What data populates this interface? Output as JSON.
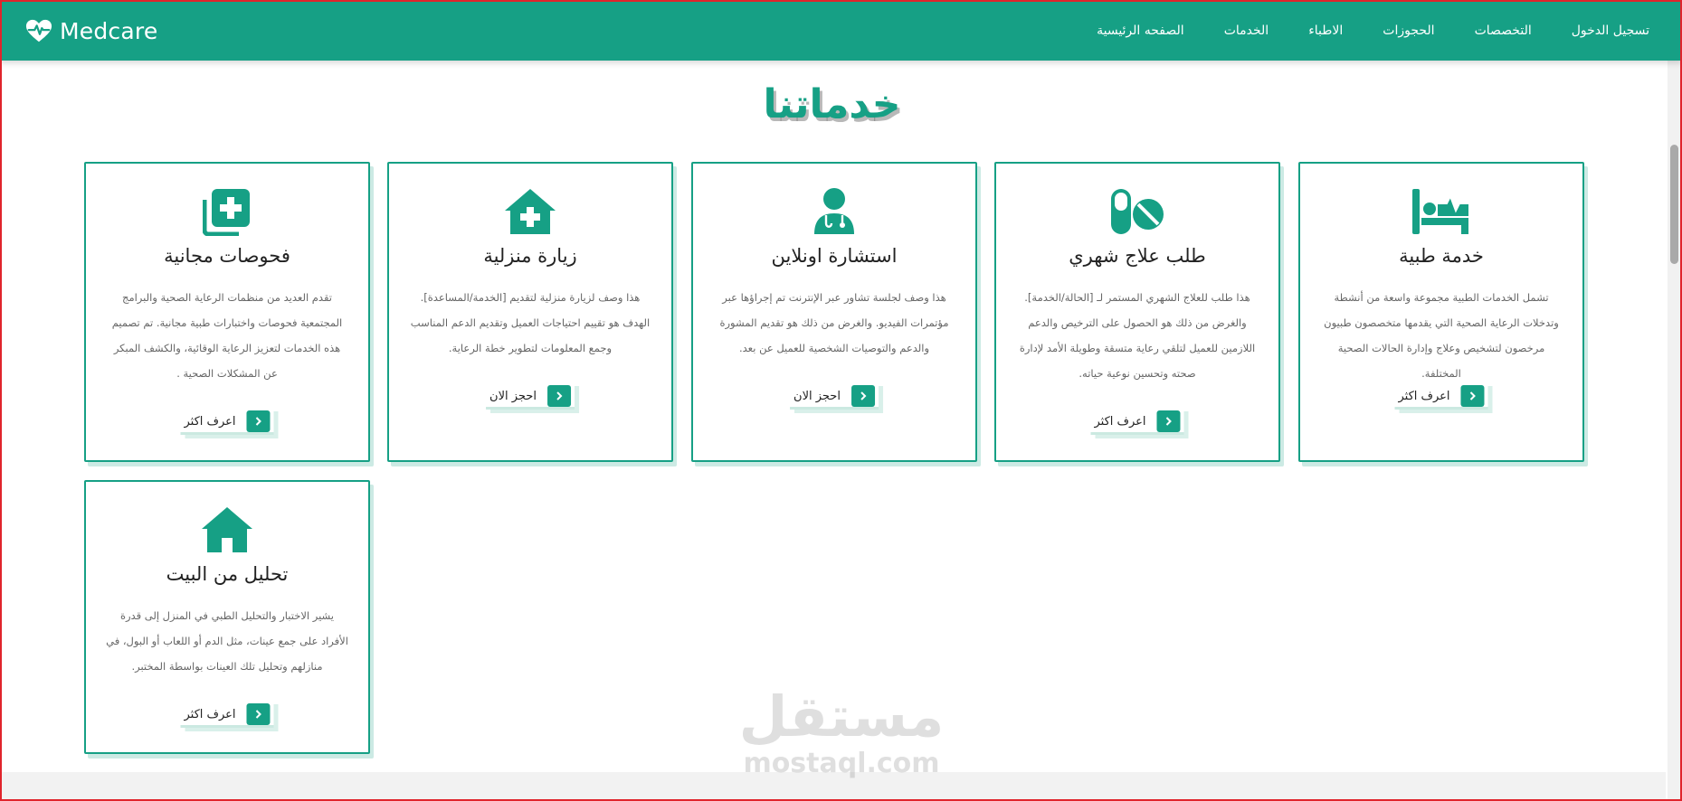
{
  "app": {
    "brand": "Medcare",
    "brand_icon": "heart-pulse-icon",
    "accent": "#16a085"
  },
  "nav": {
    "items": [
      "الصفحه الرئيسية",
      "الخدمات",
      "الاطباء",
      "الحجوزات",
      "التخصصات",
      "تسجيل الدخول"
    ]
  },
  "section": {
    "title": "خدماتنا"
  },
  "cards": [
    {
      "icon": "hospital-bed-icon",
      "title": "خدمة طبية",
      "desc": "تشمل الخدمات الطبية مجموعة واسعة من أنشطة وتدخلات الرعاية الصحية التي يقدمها متخصصون طبيون مرخصون لتشخيص وعلاج وإدارة الحالات الصحية المختلفة.",
      "button": "اعرف اكثر"
    },
    {
      "icon": "pills-icon",
      "title": "طلب علاج شهري",
      "desc": "هذا طلب للعلاج الشهري المستمر لـ [الحالة/الخدمة]. والغرض من ذلك هو الحصول على الترخيص والدعم اللازمين للعميل لتلقي رعاية متسقة وطويلة الأمد لإدارة صحته وتحسين نوعية حياته.",
      "button": "اعرف اكثر"
    },
    {
      "icon": "doctor-icon",
      "title": "استشارة اونلاين",
      "desc": "هذا وصف لجلسة تشاور عبر الإنترنت تم إجراؤها عبر مؤتمرات الفيديو. والغرض من ذلك هو تقديم المشورة والدعم والتوصيات الشخصية للعميل عن بعد.",
      "button": "احجز الان"
    },
    {
      "icon": "house-medical-icon",
      "title": "زيارة منزلية",
      "desc": "هذا وصف لزيارة منزلية لتقديم [الخدمة/المساعدة]. الهدف هو تقييم احتياجات العميل وتقديم الدعم المناسب وجمع المعلومات لتطوير خطة الرعاية.",
      "button": "احجز الان"
    },
    {
      "icon": "notes-medical-icon",
      "title": "فحوصات مجانية",
      "desc": "تقدم العديد من منظمات الرعاية الصحية والبرامج المجتمعية فحوصات واختبارات طبية مجانية. تم تصميم هذه الخدمات لتعزيز الرعاية الوقائية، والكشف المبكر عن المشكلات الصحية .",
      "button": "اعرف اكثر"
    },
    {
      "icon": "home-icon",
      "title": "تحليل من البيت",
      "desc": "يشير الاختبار والتحليل الطبي في المنزل إلى قدرة الأفراد على جمع عينات، مثل الدم أو اللعاب أو البول، في منازلهم وتحليل تلك العينات بواسطة المختبر.",
      "button": "اعرف اكثر"
    }
  ],
  "watermark": {
    "ar": "مستقل",
    "en": "mostaql.com"
  }
}
